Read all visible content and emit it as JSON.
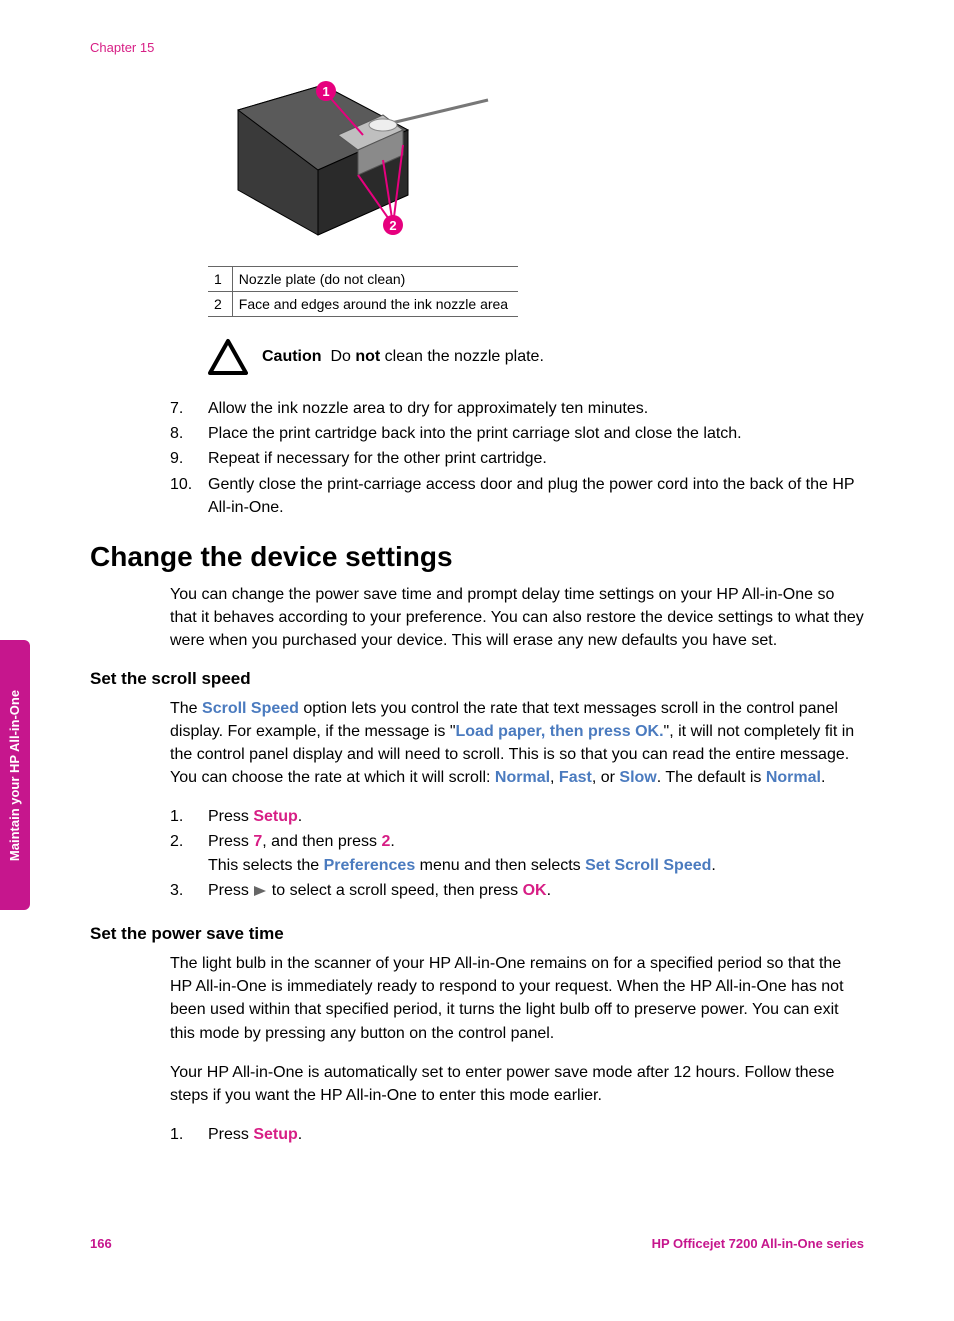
{
  "header": {
    "chapter": "Chapter 15"
  },
  "figure": {
    "callouts": [
      {
        "n": "1",
        "text": "Nozzle plate (do not clean)"
      },
      {
        "n": "2",
        "text": "Face and edges around the ink nozzle area"
      }
    ]
  },
  "caution": {
    "label": "Caution",
    "pre": "Do ",
    "bold": "not",
    "post": " clean the nozzle plate."
  },
  "steps_continue": [
    {
      "n": "7.",
      "text": "Allow the ink nozzle area to dry for approximately ten minutes."
    },
    {
      "n": "8.",
      "text": "Place the print cartridge back into the print carriage slot and close the latch."
    },
    {
      "n": "9.",
      "text": "Repeat if necessary for the other print cartridge."
    },
    {
      "n": "10.",
      "text": "Gently close the print-carriage access door and plug the power cord into the back of the HP All-in-One."
    }
  ],
  "section": {
    "title": "Change the device settings",
    "intro": "You can change the power save time and prompt delay time settings on your HP All-in-One so that it behaves according to your preference. You can also restore the device settings to what they were when you purchased your device. This will erase any new defaults you have set."
  },
  "scroll": {
    "heading": "Set the scroll speed",
    "p_a": "The ",
    "p_b": "Scroll Speed",
    "p_c": " option lets you control the rate that text messages scroll in the control panel display. For example, if the message is \"",
    "p_d": "Load paper, then press OK.",
    "p_e": "\", it will not completely fit in the control panel display and will need to scroll. This is so that you can read the entire message. You can choose the rate at which it will scroll: ",
    "p_f": "Normal",
    "comma1": ", ",
    "p_g": "Fast",
    "comma2": ", or ",
    "p_h": "Slow",
    "p_i": ". The default is ",
    "p_j": "Normal",
    "p_k": ".",
    "s1_n": "1.",
    "s1_a": "Press ",
    "s1_b": "Setup",
    "s1_c": ".",
    "s2_n": "2.",
    "s2_a": "Press ",
    "s2_b": "7",
    "s2_c": ", and then press ",
    "s2_d": "2",
    "s2_e": ".",
    "s2_f": "This selects the ",
    "s2_g": "Preferences",
    "s2_h": " menu and then selects ",
    "s2_i": "Set Scroll Speed",
    "s2_j": ".",
    "s3_n": "3.",
    "s3_a": "Press ",
    "s3_b": " to select a scroll speed, then press ",
    "s3_c": "OK",
    "s3_d": "."
  },
  "power": {
    "heading": "Set the power save time",
    "p1": "The light bulb in the scanner of your HP All-in-One remains on for a specified period so that the HP All-in-One is immediately ready to respond to your request. When the HP All-in-One has not been used within that specified period, it turns the light bulb off to preserve power. You can exit this mode by pressing any button on the control panel.",
    "p2": "Your HP All-in-One is automatically set to enter power save mode after 12 hours. Follow these steps if you want the HP All-in-One to enter this mode earlier.",
    "s1_n": "1.",
    "s1_a": "Press ",
    "s1_b": "Setup",
    "s1_c": "."
  },
  "side_tab": "Maintain your HP All-in-One",
  "footer": {
    "page": "166",
    "product": "HP Officejet 7200 All-in-One series"
  }
}
